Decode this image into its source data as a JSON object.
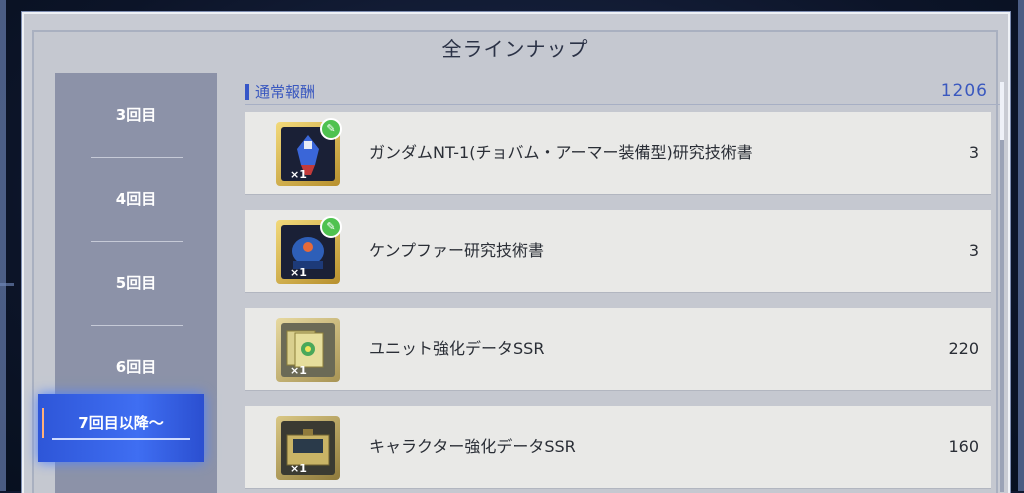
{
  "title": "全ラインナップ",
  "rounds": [
    {
      "label": "3回目"
    },
    {
      "label": "4回目"
    },
    {
      "label": "5回目"
    },
    {
      "label": "6回目"
    },
    {
      "label": "7回目以降〜"
    }
  ],
  "active_round": "7回目以降〜",
  "section": {
    "label": "通常報酬",
    "total": "1206"
  },
  "rewards": [
    {
      "name": "ガンダムNT-1(チョバム・アーマー装備型)研究技術書",
      "qty": "3",
      "count_label": "×1",
      "icon": "gundam-tech-book-icon",
      "badge": "wrench-icon"
    },
    {
      "name": "ケンプファー研究技術書",
      "qty": "3",
      "count_label": "×1",
      "icon": "kampfer-tech-book-icon",
      "badge": "wrench-icon"
    },
    {
      "name": "ユニット強化データSSR",
      "qty": "220",
      "count_label": "×1",
      "icon": "unit-data-icon"
    },
    {
      "name": "キャラクター強化データSSR",
      "qty": "160",
      "count_label": "×1",
      "icon": "character-data-icon"
    }
  ],
  "colors": {
    "accent_blue": "#3a58bf",
    "active_tab": "#3f6ef2",
    "panel": "#c8cbd3",
    "row": "#e9e9e7",
    "icon_gold": "#d8b450"
  }
}
